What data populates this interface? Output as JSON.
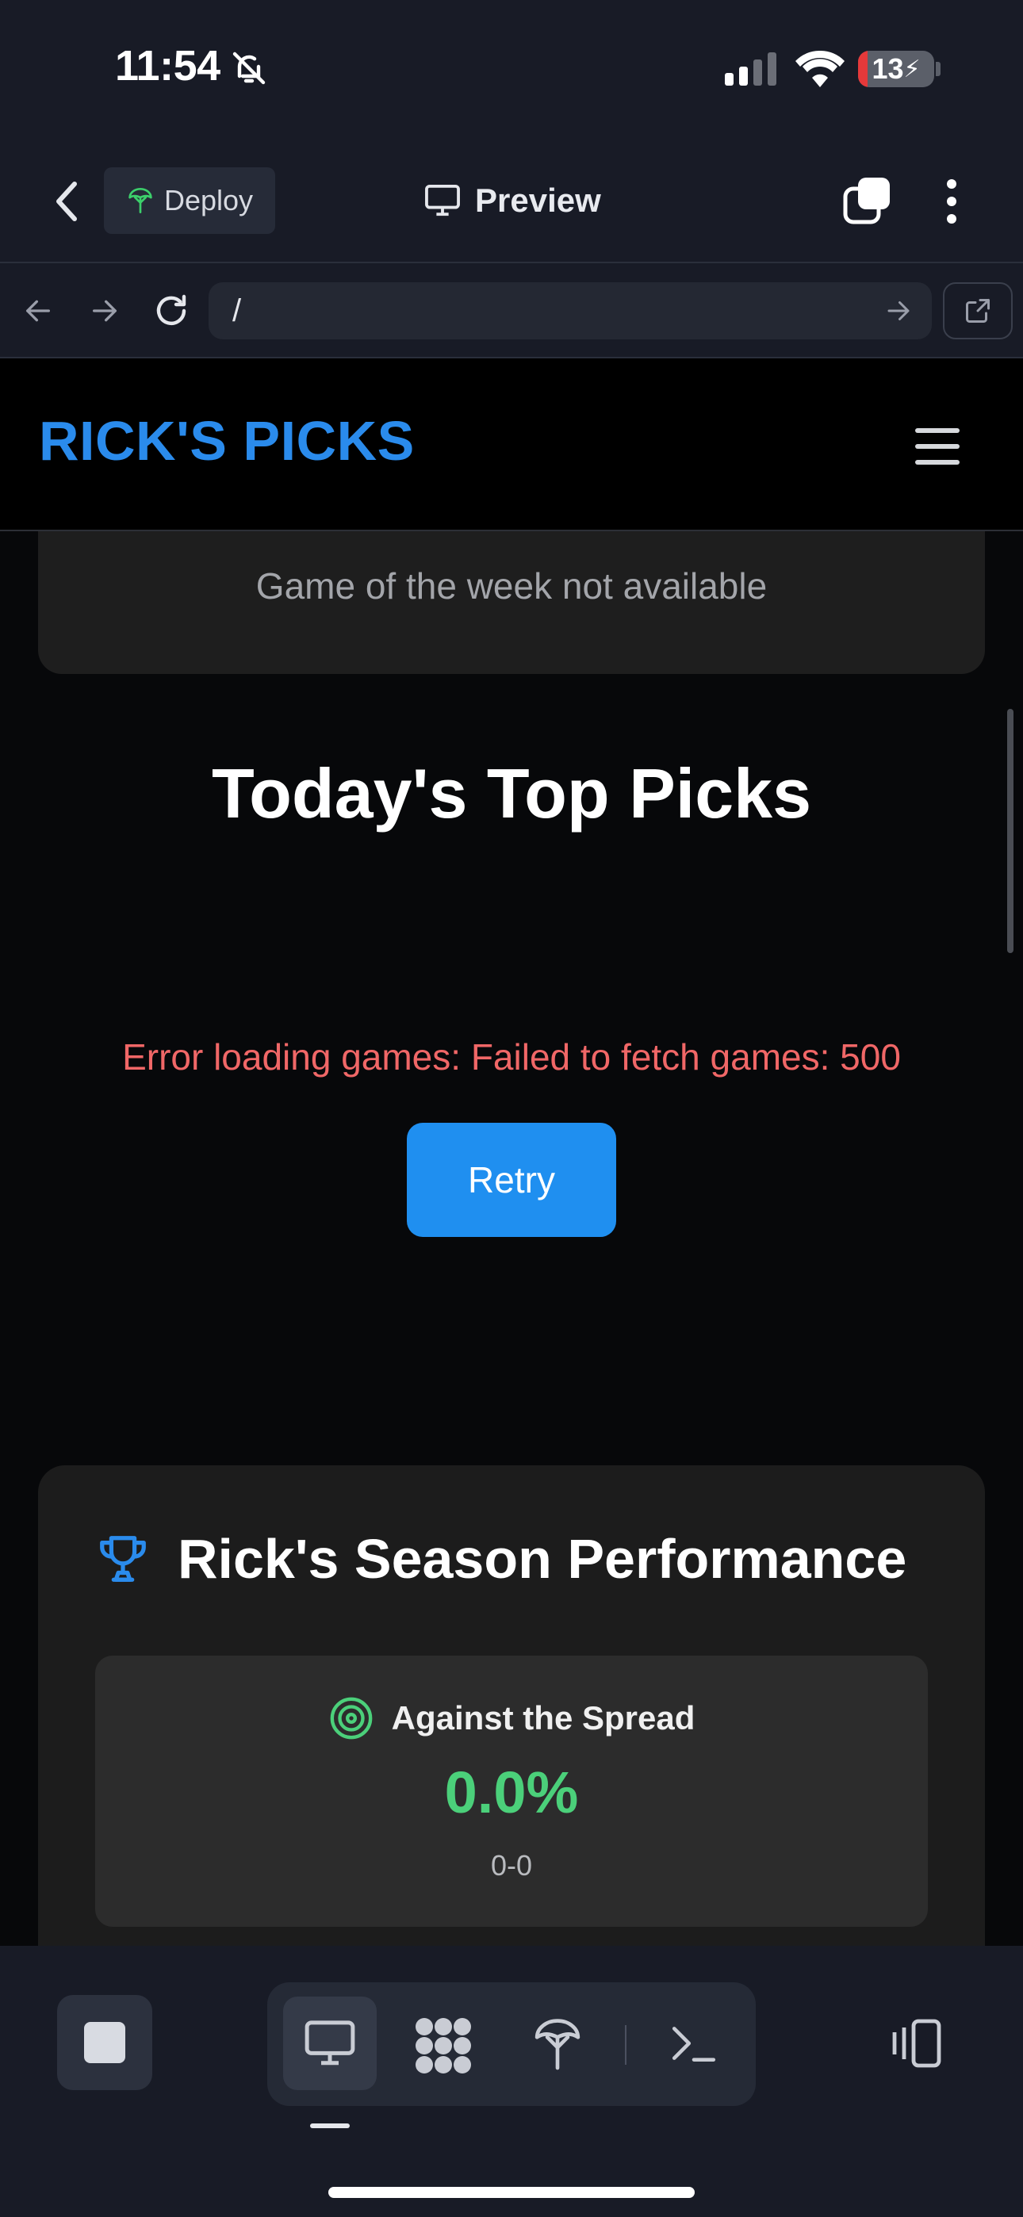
{
  "status_bar": {
    "time": "11:54",
    "battery_level": "13",
    "battery_fraction": 0.13,
    "icons": [
      "bell-slash-icon",
      "cellular-signal-icon",
      "wifi-icon",
      "battery-charging-icon"
    ]
  },
  "app_header": {
    "deploy_label": "Deploy",
    "preview_label": "Preview",
    "icons": [
      "back-chevron-icon",
      "deploy-icon",
      "monitor-icon",
      "tabs-icon",
      "more-vertical-icon"
    ]
  },
  "browser_bar": {
    "url": "/",
    "icons": [
      "arrow-left-icon",
      "arrow-right-icon",
      "reload-icon",
      "go-arrow-icon",
      "external-link-icon"
    ]
  },
  "site": {
    "logo": "RICK'S PICKS",
    "game_of_week_text": "Game of the week not available",
    "top_picks_heading": "Today's Top Picks",
    "error_message": "Error loading games: Failed to fetch games: 500",
    "retry_label": "Retry",
    "performance": {
      "title": "Rick's Season Performance",
      "ats_label": "Against the Spread",
      "ats_percentage": "0.0%",
      "ats_record": "0-0"
    }
  },
  "colors": {
    "brand_blue": "#2a8bec",
    "error_red": "#f06767",
    "success_green": "#4bd07a",
    "chrome_bg": "#181b26"
  },
  "bottom_toolbar": {
    "icons": [
      "stop-icon",
      "monitor-icon",
      "workflow-icon",
      "deploy-icon",
      "terminal-icon",
      "layout-switch-icon"
    ]
  }
}
